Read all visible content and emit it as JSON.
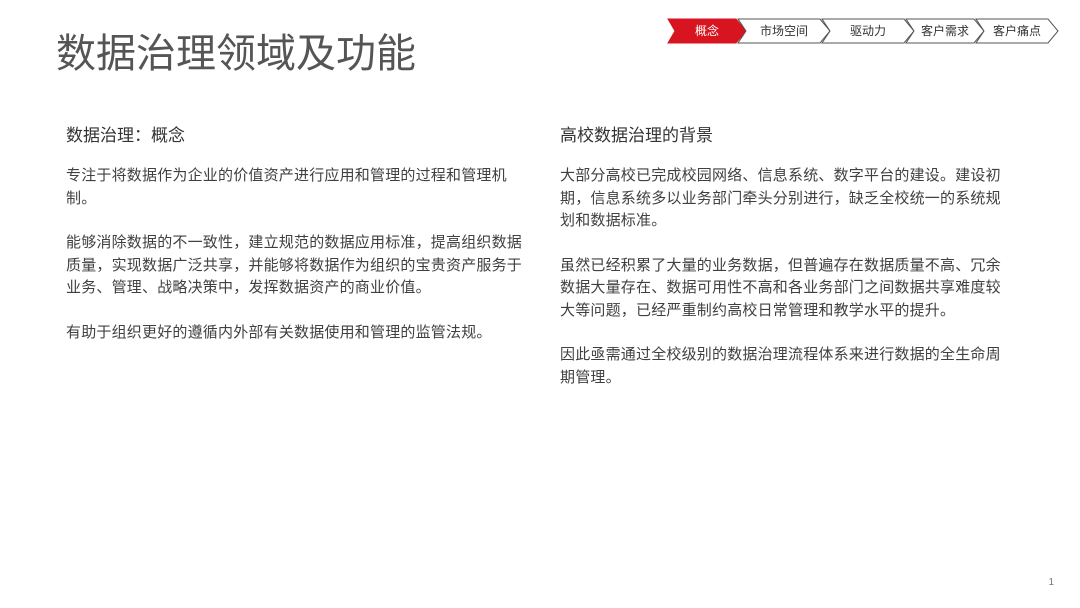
{
  "title": "数据治理领域及功能",
  "nav": {
    "items": [
      {
        "label": "概念",
        "active": true
      },
      {
        "label": "市场空间",
        "active": false
      },
      {
        "label": "驱动力",
        "active": false
      },
      {
        "label": "客户需求",
        "active": false
      },
      {
        "label": "客户痛点",
        "active": false
      }
    ],
    "active_color": "#d7141f",
    "inactive_color": "#ffffff",
    "border_color": "#555555"
  },
  "left": {
    "heading": "数据治理：概念",
    "paragraphs": [
      "专注于将数据作为企业的价值资产进行应用和管理的过程和管理机制。",
      "能够消除数据的不一致性，建立规范的数据应用标准，提高组织数据质量，实现数据广泛共享，并能够将数据作为组织的宝贵资产服务于业务、管理、战略决策中，发挥数据资产的商业价值。",
      "有助于组织更好的遵循内外部有关数据使用和管理的监管法规。"
    ]
  },
  "right": {
    "heading": "高校数据治理的背景",
    "paragraphs": [
      "大部分高校已完成校园网络、信息系统、数字平台的建设。建设初期，信息系统多以业务部门牵头分别进行，缺乏全校统一的系统规划和数据标准。",
      "虽然已经积累了大量的业务数据，但普遍存在数据质量不高、冗余数据大量存在、数据可用性不高和各业务部门之间数据共享难度较大等问题，已经严重制约高校日常管理和教学水平的提升。",
      "因此亟需通过全校级别的数据治理流程体系来进行数据的全生命周期管理。"
    ]
  },
  "page_number": "1"
}
